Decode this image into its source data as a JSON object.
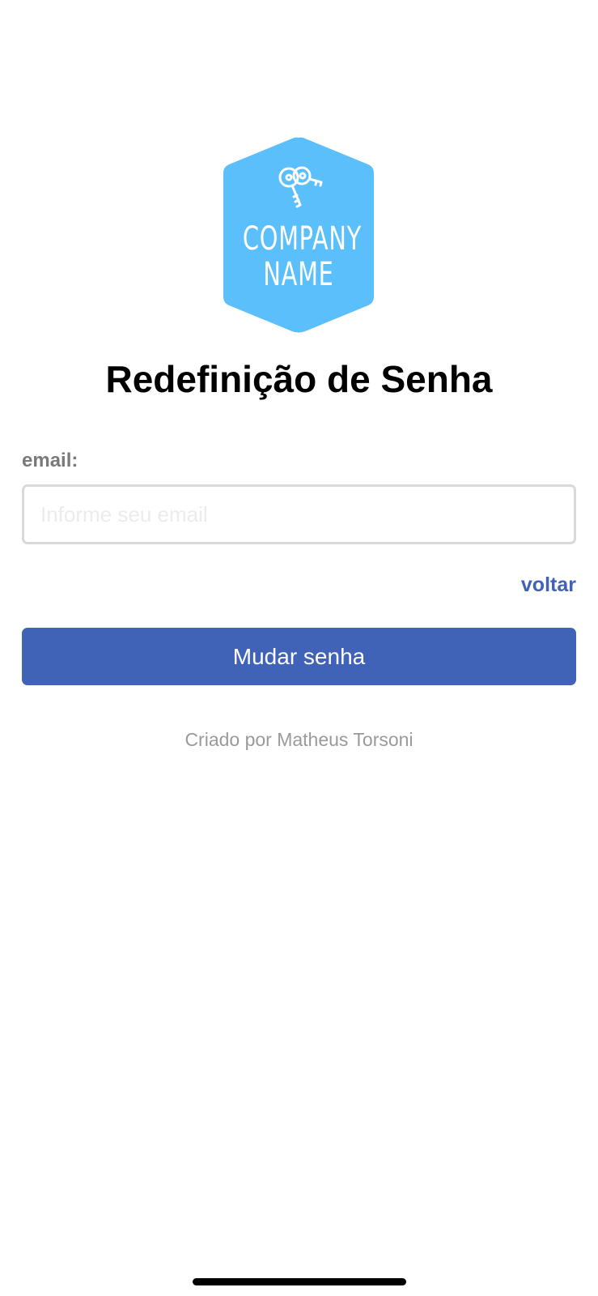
{
  "logo": {
    "line1": "COMPANY",
    "line2": "NAME",
    "icon": "keys-icon",
    "color": "#5bbffc"
  },
  "title": "Redefinição de Senha",
  "form": {
    "email_label": "email:",
    "email_value": "",
    "email_placeholder": "Informe seu email",
    "back_link": "voltar",
    "submit_label": "Mudar senha"
  },
  "footer": {
    "credit": "Criado por Matheus Torsoni"
  },
  "colors": {
    "primary": "#4062b7",
    "label": "#7a7a7a",
    "credit": "#9a9a9a"
  }
}
